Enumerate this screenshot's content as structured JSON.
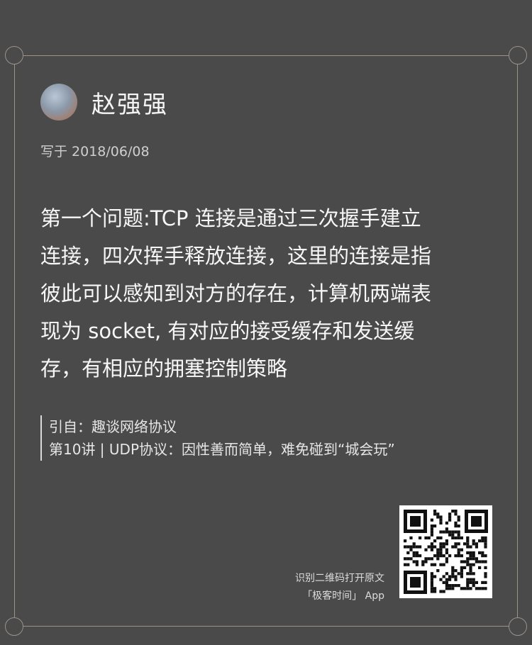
{
  "author": {
    "name": "赵强强"
  },
  "date": {
    "text": "写于 2018/06/08"
  },
  "quote": {
    "lines": [
      "第一个问题:TCP 连接是通过三次握手建立",
      "连接，四次挥手释放连接，这里的连接是指",
      "彼此可以感知到对方的存在，计算机两端表",
      "现为 socket, 有对应的接受缓存和发送缓",
      "存，有相应的拥塞控制策略"
    ]
  },
  "source": {
    "line1": "引自：趣谈网络协议",
    "line2": "第10讲 | UDP协议：因性善而简单，难免碰到“城会玩”"
  },
  "qr": {
    "hint_line1": "识别二维码打开原文",
    "hint_line2": "「极客时间」 App",
    "icon": "qr-code-icon"
  },
  "colors": {
    "background": "#4a4a4a",
    "frame": "#9b928a",
    "text": "#f2f2f2"
  }
}
